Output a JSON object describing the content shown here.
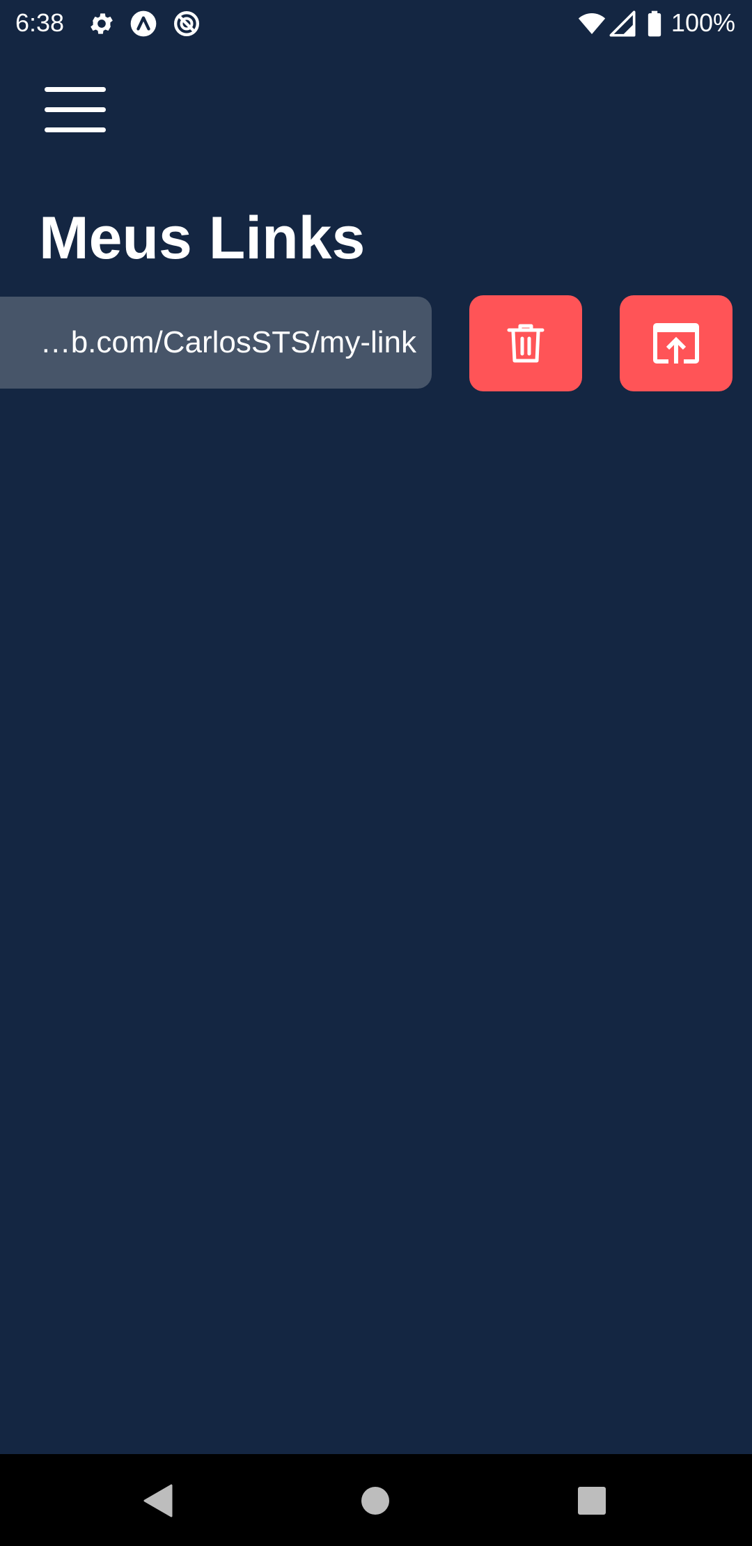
{
  "status_bar": {
    "time": "6:38",
    "battery_text": "100%",
    "icons": [
      "settings-icon",
      "app-a-icon",
      "app-q-icon",
      "wifi-icon",
      "signal-icon",
      "battery-icon"
    ]
  },
  "header": {
    "menu_icon": "hamburger-menu-icon",
    "title": "Meus Links"
  },
  "links": [
    {
      "url_visible": "b.com/CarlosSTS/my-link…",
      "delete_icon": "trash-icon",
      "open_icon": "open-in-window-icon"
    }
  ],
  "colors": {
    "background": "#142642",
    "link_field": "#475569",
    "accent": "#ff5457",
    "nav_bar": "#000000"
  },
  "nav_bar": {
    "icons": [
      "back-triangle-icon",
      "home-circle-icon",
      "recents-square-icon"
    ]
  }
}
